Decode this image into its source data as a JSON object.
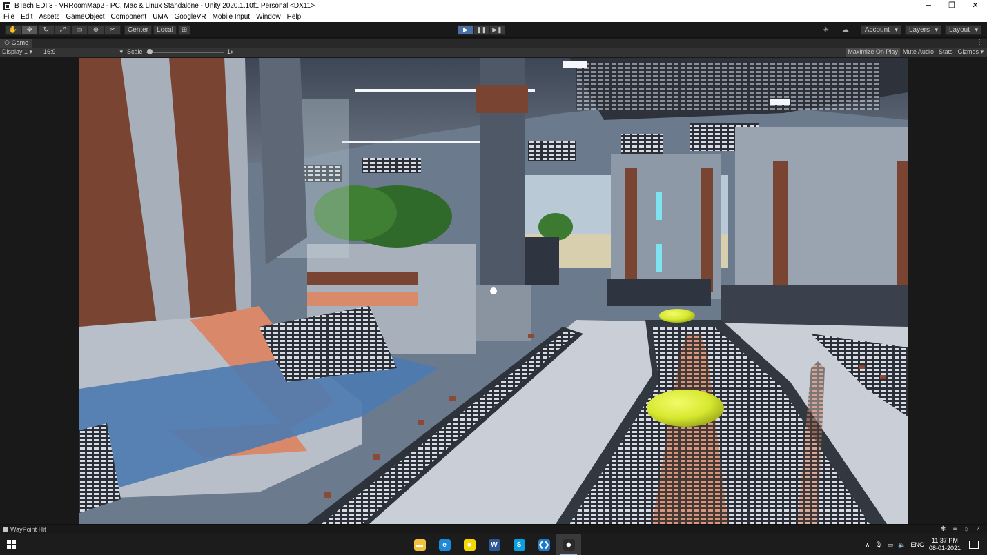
{
  "window": {
    "title": "BTech EDI 3 - VRRoomMap2 - PC, Mac & Linux Standalone - Unity 2020.1.10f1 Personal <DX11>",
    "controls": [
      "─",
      "❐",
      "✕"
    ]
  },
  "menu": [
    "File",
    "Edit",
    "Assets",
    "GameObject",
    "Component",
    "UMA",
    "GoogleVR",
    "Mobile Input",
    "Window",
    "Help"
  ],
  "toolbar": {
    "tools": [
      {
        "icon": "hand-icon",
        "glyph": "✋"
      },
      {
        "icon": "move-icon",
        "glyph": "✥"
      },
      {
        "icon": "rotate-icon",
        "glyph": "↻"
      },
      {
        "icon": "scale-icon",
        "glyph": "⤢"
      },
      {
        "icon": "rect-icon",
        "glyph": "▭"
      },
      {
        "icon": "transform-icon",
        "glyph": "⊕"
      },
      {
        "icon": "custom-tool-icon",
        "glyph": "✂"
      }
    ],
    "pivot_center": "Center",
    "pivot_local": "Local",
    "play": "▶",
    "pause": "❚❚",
    "step": "▶❚",
    "account": "Account",
    "layers": "Layers",
    "layout": "Layout"
  },
  "tab": {
    "label": "Game",
    "menu": "⋮"
  },
  "gamebar": {
    "display": "Display 1  ▾",
    "aspect": "16:9",
    "scale_label": "Scale",
    "scale_value": "1x",
    "scale_level": 0.02,
    "maximize": "Maximize On Play",
    "mute": "Mute Audio",
    "stats": "Stats",
    "gizmos": "Gizmos  ▾"
  },
  "status": {
    "message": "WayPoint Hit"
  },
  "taskbar": {
    "apps": [
      {
        "name": "file-explorer",
        "glyph": "▬",
        "color": "#f3c23c"
      },
      {
        "name": "edge",
        "glyph": "e",
        "color": "#1c8ad8"
      },
      {
        "name": "sticky-notes",
        "glyph": "■",
        "color": "#f5d800"
      },
      {
        "name": "word",
        "glyph": "W",
        "color": "#2b5797"
      },
      {
        "name": "skype",
        "glyph": "S",
        "color": "#0aa0e0"
      },
      {
        "name": "vs-code",
        "glyph": "❮❯",
        "color": "#1f7ac8"
      },
      {
        "name": "unity",
        "glyph": "◆",
        "color": "#2a2a2a"
      }
    ],
    "lang": "ENG",
    "time": "11:37 PM",
    "date": "08-01-2021"
  },
  "colors": {
    "editor_bg": "#191919",
    "accent": "#4a6fa5",
    "waypoint": "#d7e830"
  }
}
